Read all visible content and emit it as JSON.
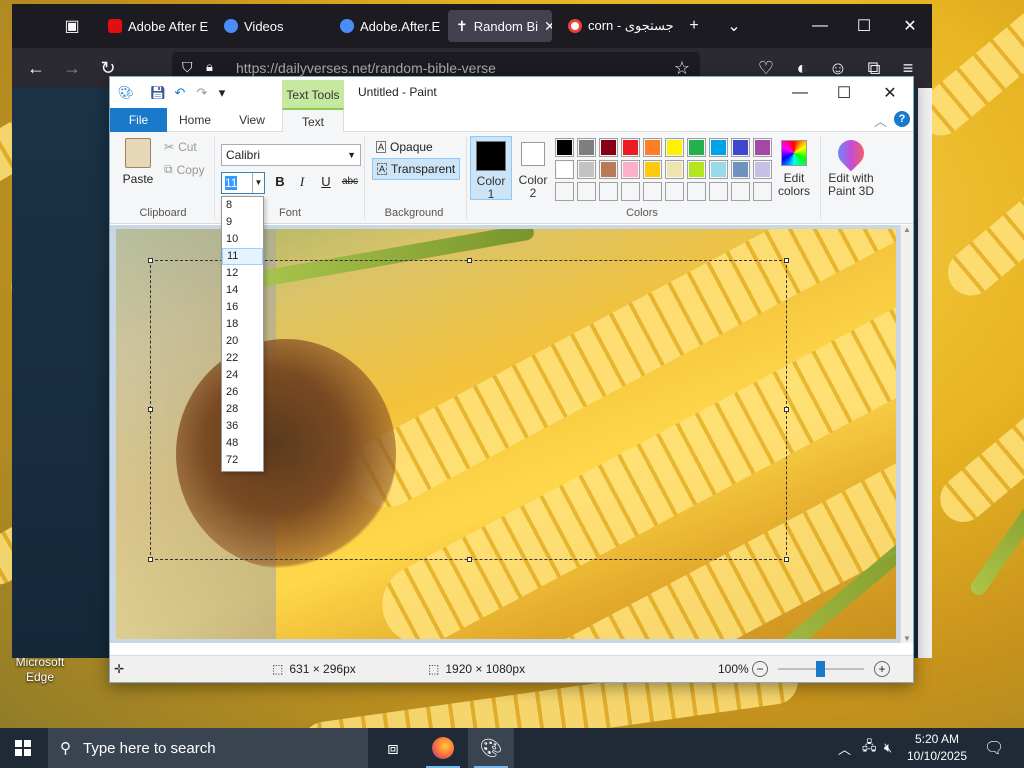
{
  "desktop": {
    "icon_label_line1": "Microsoft",
    "icon_label_line2": "Edge"
  },
  "browser": {
    "tabs": [
      {
        "label": "Adobe After E",
        "icon": "adobe-icon",
        "color": "#e01010"
      },
      {
        "label": "Videos",
        "icon": "video-icon",
        "color": "#4a8df8"
      },
      {
        "label": "Adobe.After.E",
        "icon": "video-icon",
        "color": "#4a8df8"
      },
      {
        "label": "Random Bi",
        "icon": "cross-icon",
        "color": "#ffffff"
      },
      {
        "label": "corn - جستجوی",
        "icon": "google-icon",
        "color": "#ea4335"
      }
    ],
    "url": "https://dailyverses.net/random-bible-verse"
  },
  "paint": {
    "title": "Untitled - Paint",
    "context_tab": "Text Tools",
    "ribbon_tabs": {
      "file": "File",
      "home": "Home",
      "view": "View",
      "text": "Text"
    },
    "clipboard": {
      "paste": "Paste",
      "cut": "Cut",
      "copy": "Copy",
      "group": "Clipboard"
    },
    "font": {
      "family": "Calibri",
      "size": "11",
      "group": "Font",
      "bold": "B",
      "italic": "I",
      "underline": "U",
      "strike": "abc"
    },
    "background": {
      "opaque": "Opaque",
      "transparent": "Transparent",
      "group": "Background"
    },
    "colors": {
      "color1": "Color 1",
      "color1_line1": "Color",
      "color1_line2": "1",
      "color2_line1": "Color",
      "color2_line2": "2",
      "edit_colors_line1": "Edit",
      "edit_colors_line2": "colors",
      "edit_3d_line1": "Edit with",
      "edit_3d_line2": "Paint 3D",
      "group": "Colors",
      "color1_value": "#000000",
      "color2_value": "#ffffff",
      "palette_row1": [
        "#000000",
        "#7f7f7f",
        "#880015",
        "#ed1c24",
        "#ff7f27",
        "#fff200",
        "#22b14c",
        "#00a2e8",
        "#3f48cc",
        "#a349a4"
      ],
      "palette_row2": [
        "#ffffff",
        "#c3c3c3",
        "#b97a57",
        "#ffaec9",
        "#ffc90e",
        "#efe4b0",
        "#b5e61d",
        "#99d9ea",
        "#7092be",
        "#c8bfe7"
      ]
    },
    "font_sizes": [
      "8",
      "9",
      "10",
      "11",
      "12",
      "14",
      "16",
      "18",
      "20",
      "22",
      "24",
      "26",
      "28",
      "36",
      "48",
      "72"
    ],
    "selected_size_index": 3,
    "status": {
      "selection": "631 × 296px",
      "image_size": "1920 × 1080px",
      "zoom": "100%"
    }
  },
  "taskbar": {
    "search_placeholder": "Type here to search",
    "time": "5:20 AM",
    "date": "10/10/2025"
  }
}
